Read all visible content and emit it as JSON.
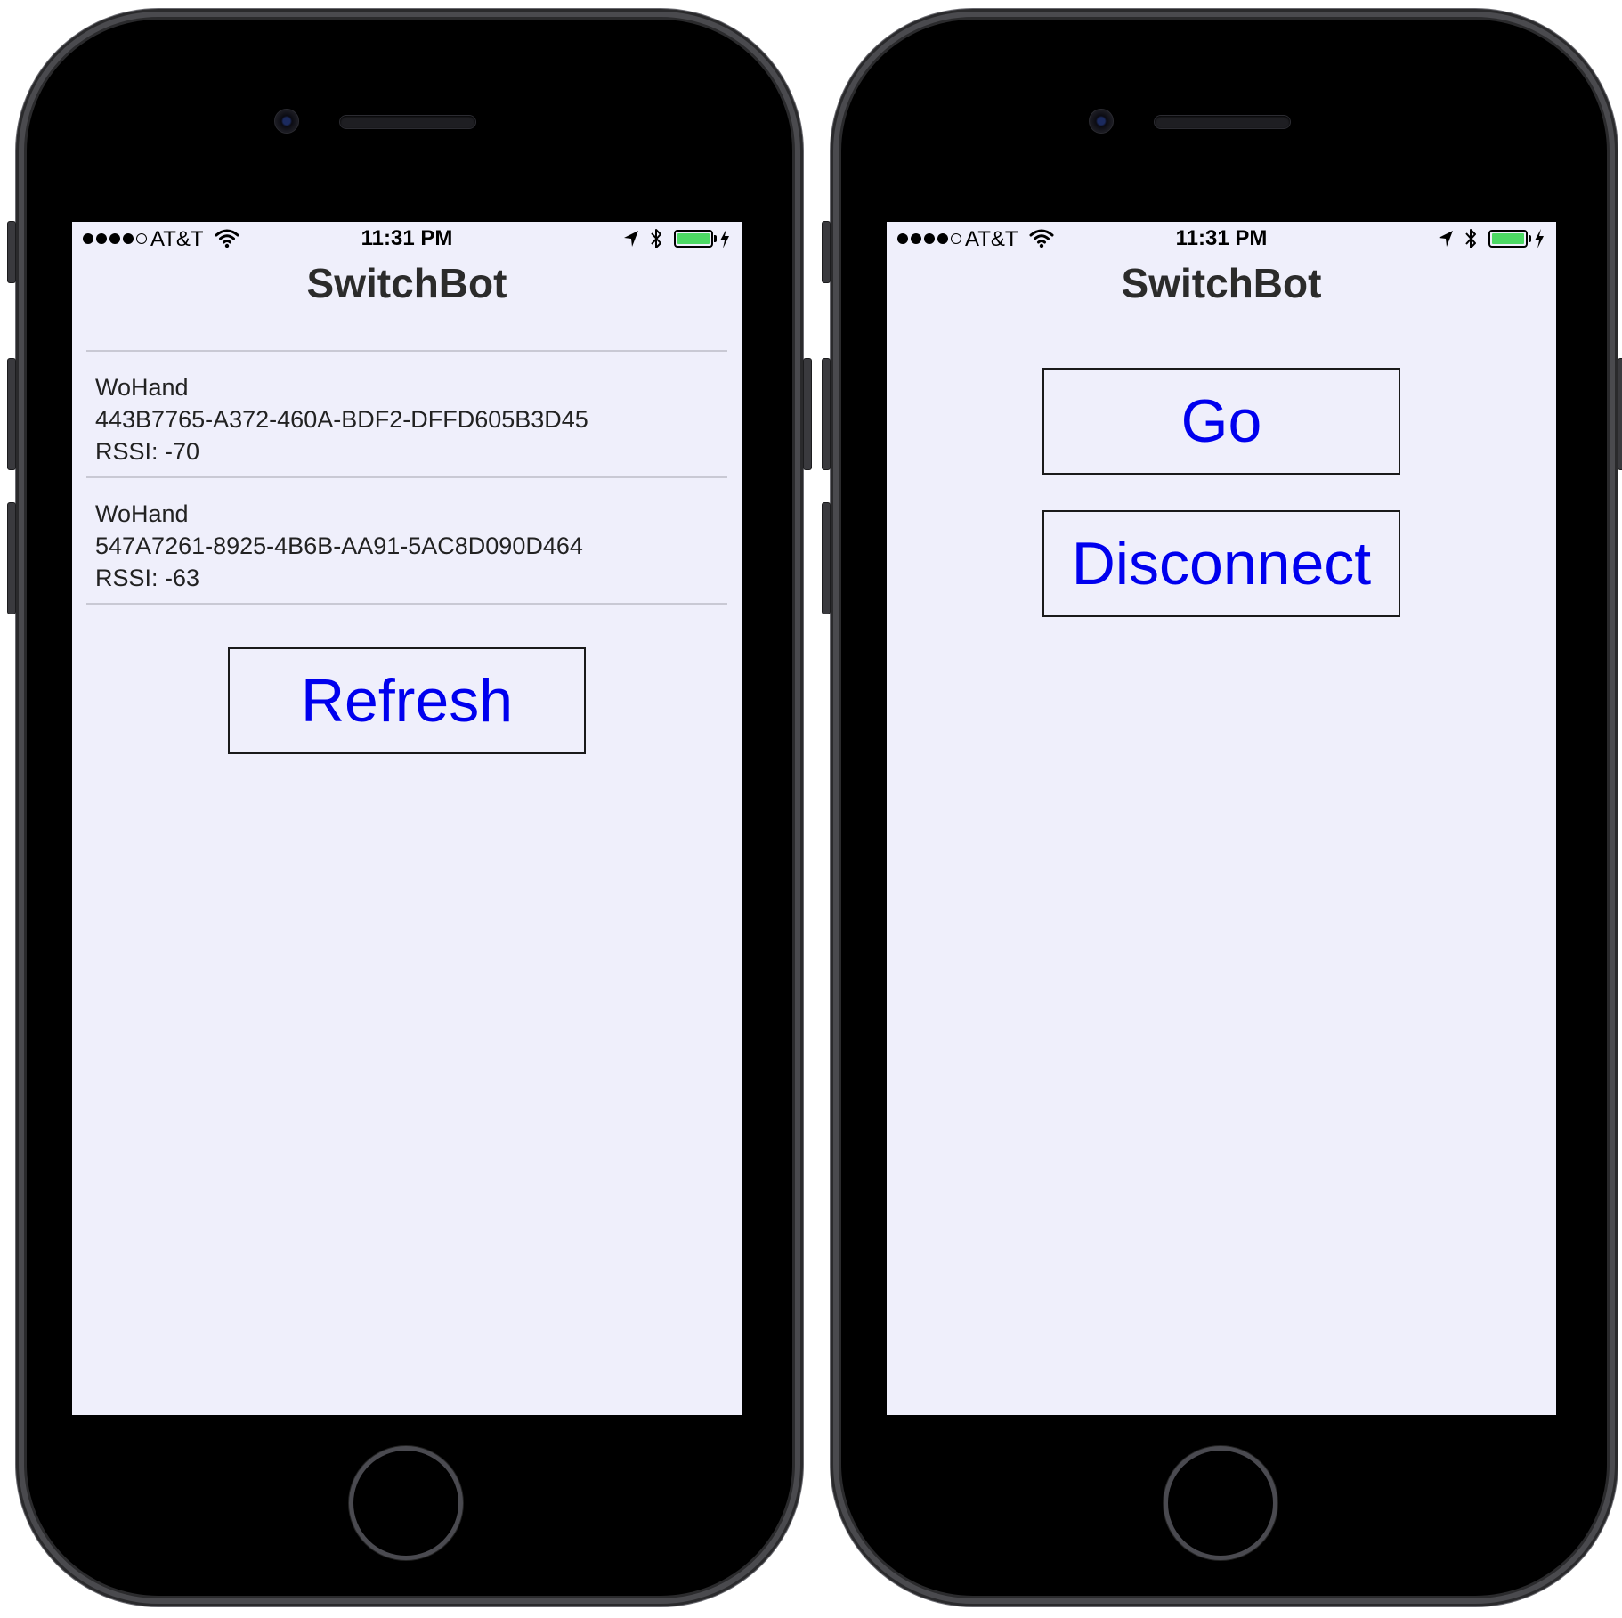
{
  "colors": {
    "screen_background": "#efeffb",
    "button_text": "#0000ee",
    "battery_fill": "#4cd964"
  },
  "left_phone": {
    "status_bar": {
      "carrier": "AT&T",
      "time": "11:31 PM",
      "signal_bars_filled": 4,
      "signal_bars_total": 5,
      "icons": [
        "wifi-icon",
        "location-arrow-icon",
        "bluetooth-icon",
        "battery-icon",
        "charging-bolt-icon"
      ]
    },
    "title": "SwitchBot",
    "devices": [
      {
        "name": "WoHand",
        "uuid": "443B7765-A372-460A-BDF2-DFFD605B3D45",
        "rssi": "RSSI: -70"
      },
      {
        "name": "WoHand",
        "uuid": "547A7261-8925-4B6B-AA91-5AC8D090D464",
        "rssi": "RSSI: -63"
      }
    ],
    "refresh_label": "Refresh"
  },
  "right_phone": {
    "status_bar": {
      "carrier": "AT&T",
      "time": "11:31 PM",
      "signal_bars_filled": 4,
      "signal_bars_total": 5,
      "icons": [
        "wifi-icon",
        "location-arrow-icon",
        "bluetooth-icon",
        "battery-icon",
        "charging-bolt-icon"
      ]
    },
    "title": "SwitchBot",
    "go_label": "Go",
    "disconnect_label": "Disconnect"
  }
}
